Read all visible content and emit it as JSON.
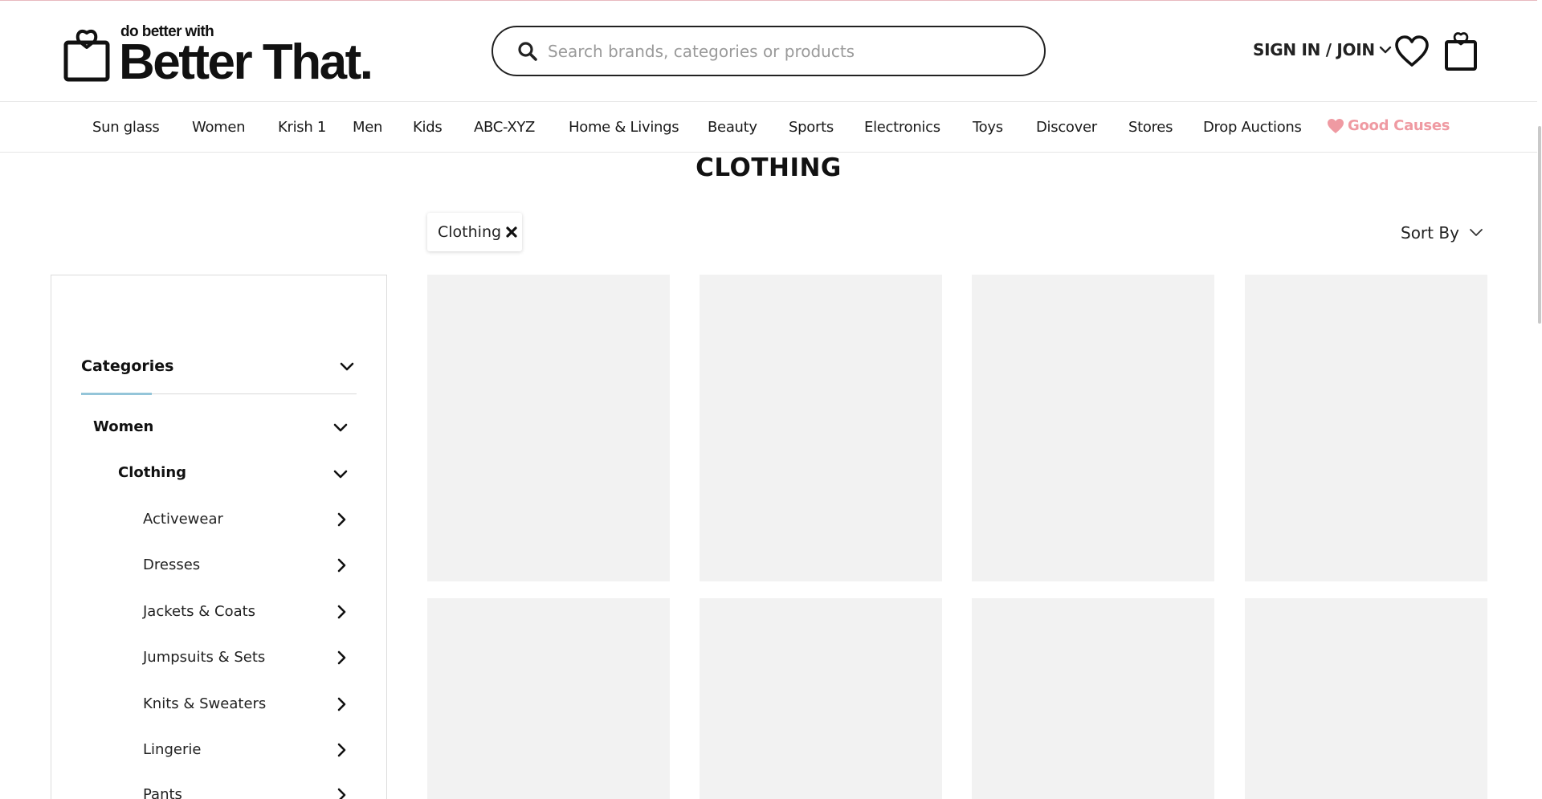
{
  "brand": {
    "tagline": "do better with",
    "name": "Better That."
  },
  "search": {
    "placeholder": "Search brands, categories or products",
    "value": ""
  },
  "account": {
    "signin_label": "SIGN IN / JOIN"
  },
  "nav": {
    "items": [
      "Sun glass",
      "Women",
      "Krish 1",
      "Men",
      "Kids",
      "ABC-XYZ",
      "Home & Livings",
      "Beauty",
      "Sports",
      "Electronics",
      "Toys",
      "Discover",
      "Stores",
      "Drop Auctions"
    ],
    "good_causes": "Good Causes"
  },
  "page": {
    "title": "CLOTHING",
    "active_filter": "Clothing",
    "sort_label": "Sort By"
  },
  "sidebar": {
    "heading": "Categories",
    "level1": "Women",
    "level2": "Clothing",
    "subcategories": [
      "Activewear",
      "Dresses",
      "Jackets & Coats",
      "Jumpsuits & Sets",
      "Knits & Sweaters",
      "Lingerie",
      "Pants"
    ]
  },
  "colors": {
    "accent_pink": "#ef9aa2",
    "underline_blue": "#94c5d9",
    "tile_placeholder": "#f2f2f2"
  },
  "icons": {
    "search": "search-icon",
    "wishlist": "heart-icon",
    "cart": "shopping-bag-icon",
    "account_menu": "chevron-down-icon",
    "filter_remove": "close-icon",
    "sort": "chevron-down-icon"
  }
}
